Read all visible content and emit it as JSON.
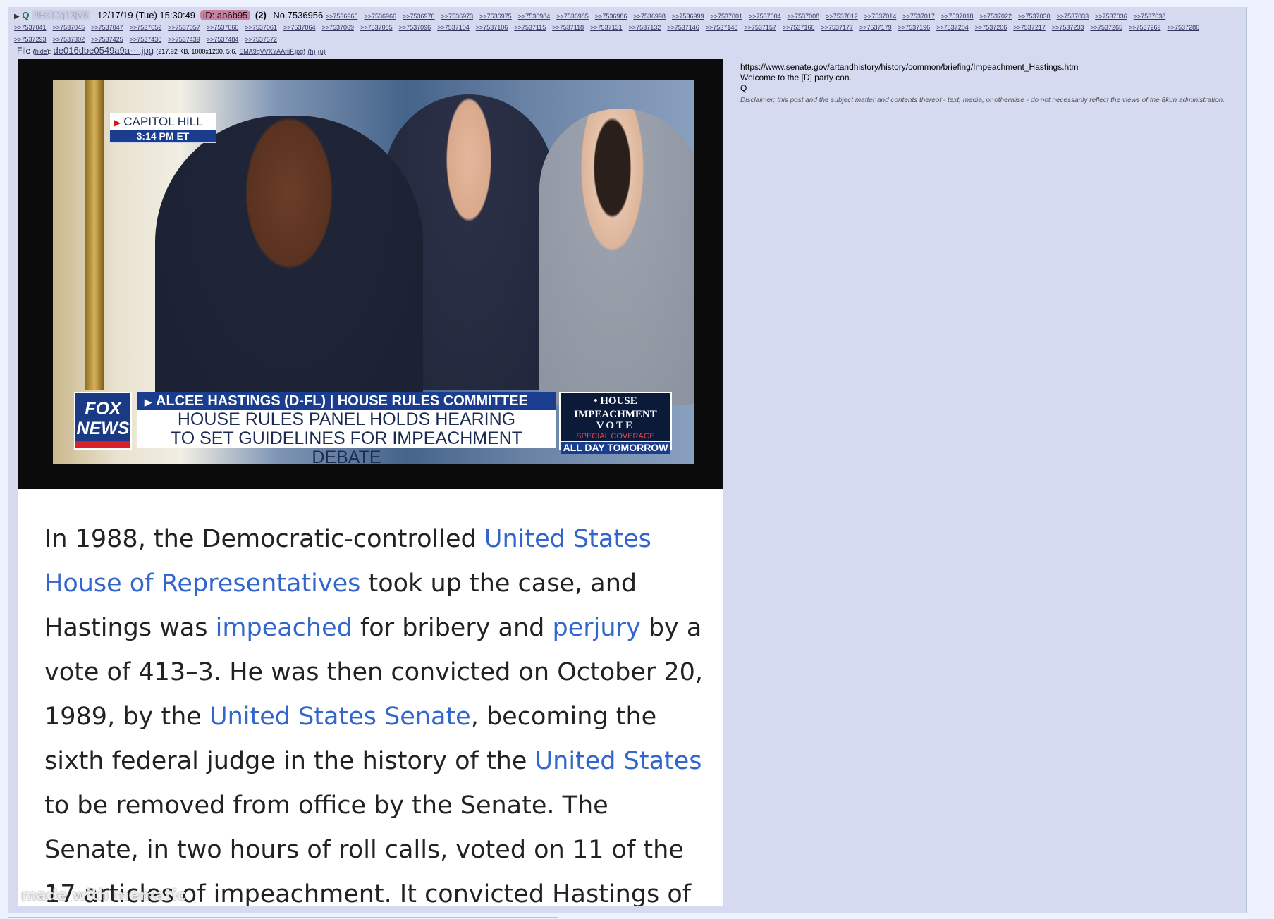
{
  "post": {
    "name": "Q",
    "tripcode": "!!Hs1Jq13jV6",
    "datetime": "12/17/19 (Tue) 15:30:49",
    "id_label": "ID: ab6b95",
    "id_count": "(2)",
    "post_number": "No.7536956",
    "backlinks": [
      ">>7536965",
      ">>7536966",
      ">>7536970",
      ">>7536973",
      ">>7536975",
      ">>7536984",
      ">>7536985",
      ">>7536986",
      ">>7536998",
      ">>7536999",
      ">>7537001",
      ">>7537004",
      ">>7537008",
      ">>7537012",
      ">>7537014",
      ">>7537017",
      ">>7537018",
      ">>7537022",
      ">>7537030",
      ">>7537033",
      ">>7537036",
      ">>7537038",
      ">>7537041",
      ">>7537045",
      ">>7537047",
      ">>7537052",
      ">>7537057",
      ">>7537060",
      ">>7537061",
      ">>7537064",
      ">>7537069",
      ">>7537085",
      ">>7537096",
      ">>7537104",
      ">>7537106",
      ">>7537115",
      ">>7537118",
      ">>7537131",
      ">>7537132",
      ">>7537146",
      ">>7537148",
      ">>7537157",
      ">>7537160",
      ">>7537177",
      ">>7537179",
      ">>7537196",
      ">>7537204",
      ">>7537206",
      ">>7537217",
      ">>7537233",
      ">>7537265",
      ">>7537269",
      ">>7537286",
      ">>7537293",
      ">>7537302",
      ">>7537425",
      ">>7537436",
      ">>7537439",
      ">>7537484",
      ">>7537572"
    ],
    "file": {
      "label": "File",
      "hide": "hide",
      "filename": "de016dbe0549a9a···.jpg",
      "meta": "(217.92 KB, 1000x1200, 5:6,",
      "original_name": "EMA9gVVXYAAriiF.jpg",
      "h": "(h)",
      "u": "(u)"
    },
    "message": {
      "link": "https://www.senate.gov/artandhistory/history/common/briefing/Impeachment_Hastings.htm",
      "line2": "Welcome to the [D] party con.",
      "line3": "Q"
    },
    "disclaimer": "Disclaimer: this post and the subject matter and contents thereof - text, media, or otherwise - do not necessarily reflect the views of the 8kun administration."
  },
  "image": {
    "location": "CAPITOL HILL",
    "time": "3:14 PM ET",
    "fox_logo_line1": "FOX",
    "fox_logo_line2": "NEWS",
    "name_band": "ALCEE HASTINGS (D-FL) | HOUSE RULES COMMITTEE",
    "headline_line1": "HOUSE RULES PANEL HOLDS HEARING",
    "headline_line2": "TO SET GUIDELINES FOR IMPEACHMENT DEBATE",
    "box_line1": "• HOUSE",
    "box_line2": "IMPEACHMENT",
    "box_line3": "VOTE",
    "box_line4": "SPECIAL COVERAGE",
    "box_line5": "ALL DAY TOMORROW",
    "article": [
      {
        "t": "In 1988, the Democratic-controlled ",
        "link": false
      },
      {
        "t": "United States House of Representatives",
        "link": true
      },
      {
        "t": " took up the case, and Hastings was ",
        "link": false
      },
      {
        "t": "impeached",
        "link": true
      },
      {
        "t": " for bribery and ",
        "link": false
      },
      {
        "t": "perjury",
        "link": true
      },
      {
        "t": " by a vote of 413–3. He was then convicted on October 20, 1989, by the ",
        "link": false
      },
      {
        "t": "United States Senate",
        "link": true
      },
      {
        "t": ", becoming the sixth federal judge in the history of the ",
        "link": false
      },
      {
        "t": "United States",
        "link": true
      },
      {
        "t": " to be removed from office by the Senate. The Senate, in two hours of roll calls, voted on 11 of the 17 articles of impeachment. It convicted Hastings of",
        "link": false
      }
    ],
    "watermark": "made with mematic"
  },
  "colors": {
    "page_bg": "#eef2ff",
    "post_bg": "#d6daf0",
    "name_green": "#117743",
    "link_color": "#34345c",
    "article_link": "#3366cc"
  }
}
